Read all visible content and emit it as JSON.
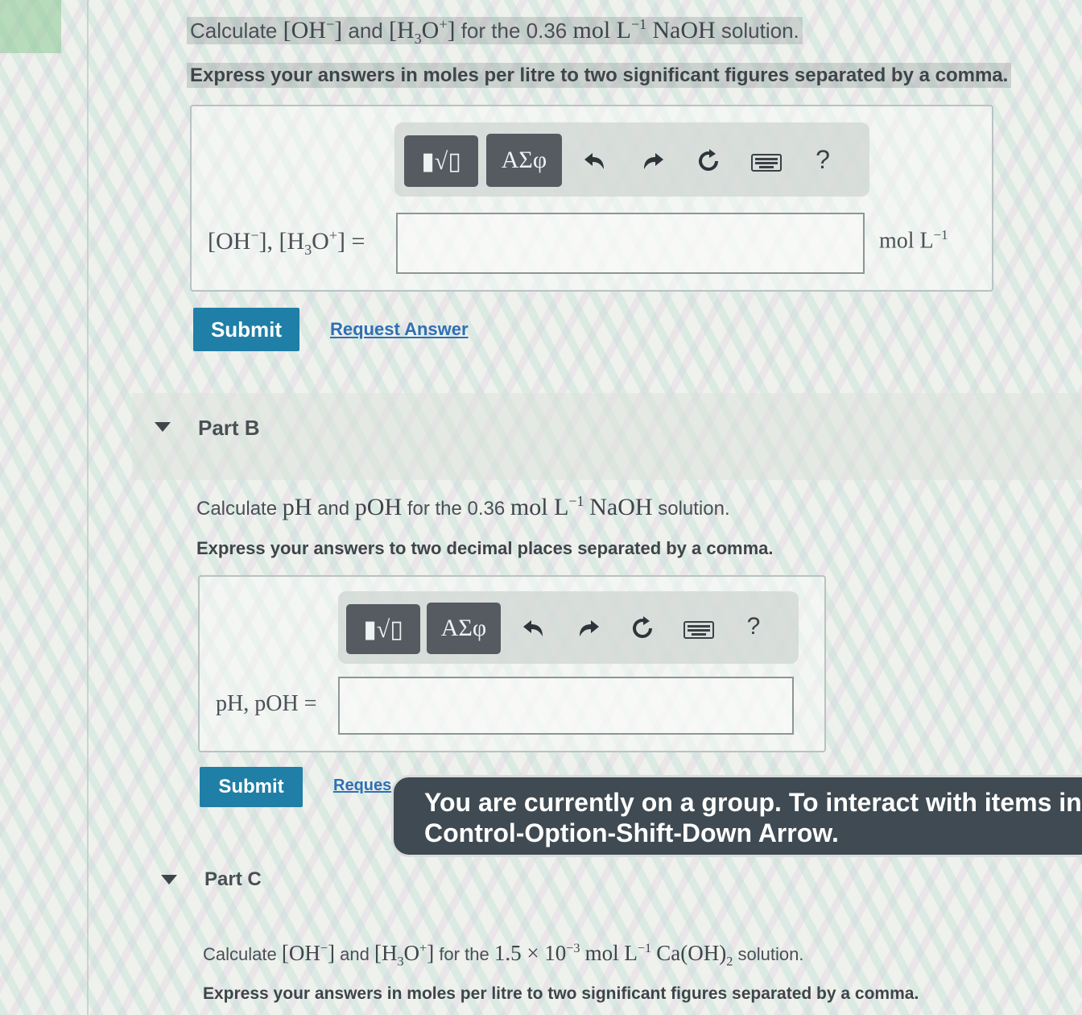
{
  "part_a": {
    "q_calculate": "Calculate",
    "q_oh": "[OH",
    "q_oh_sup": "−",
    "q_oh_close": "]",
    "q_and": "and",
    "q_h3o_open": "[H",
    "q_h3o_sub": "3",
    "q_h3o_o": "O",
    "q_h3o_sup": "+",
    "q_h3o_close": "]",
    "q_for_the": "for the 0.36",
    "q_mol": "mol L",
    "q_mol_sup": "−1",
    "q_naoh": "NaOH",
    "q_solution": "solution.",
    "instruction": "Express your answers in moles per litre to two significant figures separated by a comma.",
    "field_label_a": "[OH",
    "field_label_a_sup": "−",
    "field_label_b": "], [H",
    "field_label_b_sub": "3",
    "field_label_c": "O",
    "field_label_c_sup": "+",
    "field_label_d": "] =",
    "unit": "mol L",
    "unit_sup": "−1",
    "submit": "Submit",
    "request_answer": "Request Answer"
  },
  "toolbar": {
    "templates_label": "▮√▯",
    "greek_label": "ΑΣφ",
    "help_label": "?"
  },
  "part_b": {
    "header": "Part B",
    "q_calculate": "Calculate",
    "q_ph": "pH",
    "q_and": "and",
    "q_poh": "pOH",
    "q_for_the": "for the 0.36",
    "q_mol": "mol L",
    "q_mol_sup": "−1",
    "q_naoh": "NaOH",
    "q_solution": "solution.",
    "instruction": "Express your answers to two decimal places separated by a comma.",
    "field_label": "pH, pOH =",
    "submit": "Submit",
    "request_partial": "Reques"
  },
  "part_c": {
    "header": "Part C",
    "q_calculate": "Calculate",
    "q_oh": "[OH",
    "q_oh_sup": "−",
    "q_oh_close": "]",
    "q_and": "and",
    "q_h3o_open": "[H",
    "q_h3o_sub": "3",
    "q_h3o_o": "O",
    "q_h3o_sup": "+",
    "q_h3o_close": "]",
    "q_for_the": "for the",
    "q_value": "1.5 × 10",
    "q_value_sup": "−3",
    "q_mol": "mol L",
    "q_mol_sup": "−1",
    "q_caoh": "Ca(OH)",
    "q_caoh_sub": "2",
    "q_solution": "solution.",
    "instruction": "Express your answers in moles per litre to two significant figures separated by a comma."
  },
  "tooltip": {
    "line1": "You are currently on a group. To interact with items in",
    "line2": "Control-Option-Shift-Down Arrow."
  }
}
